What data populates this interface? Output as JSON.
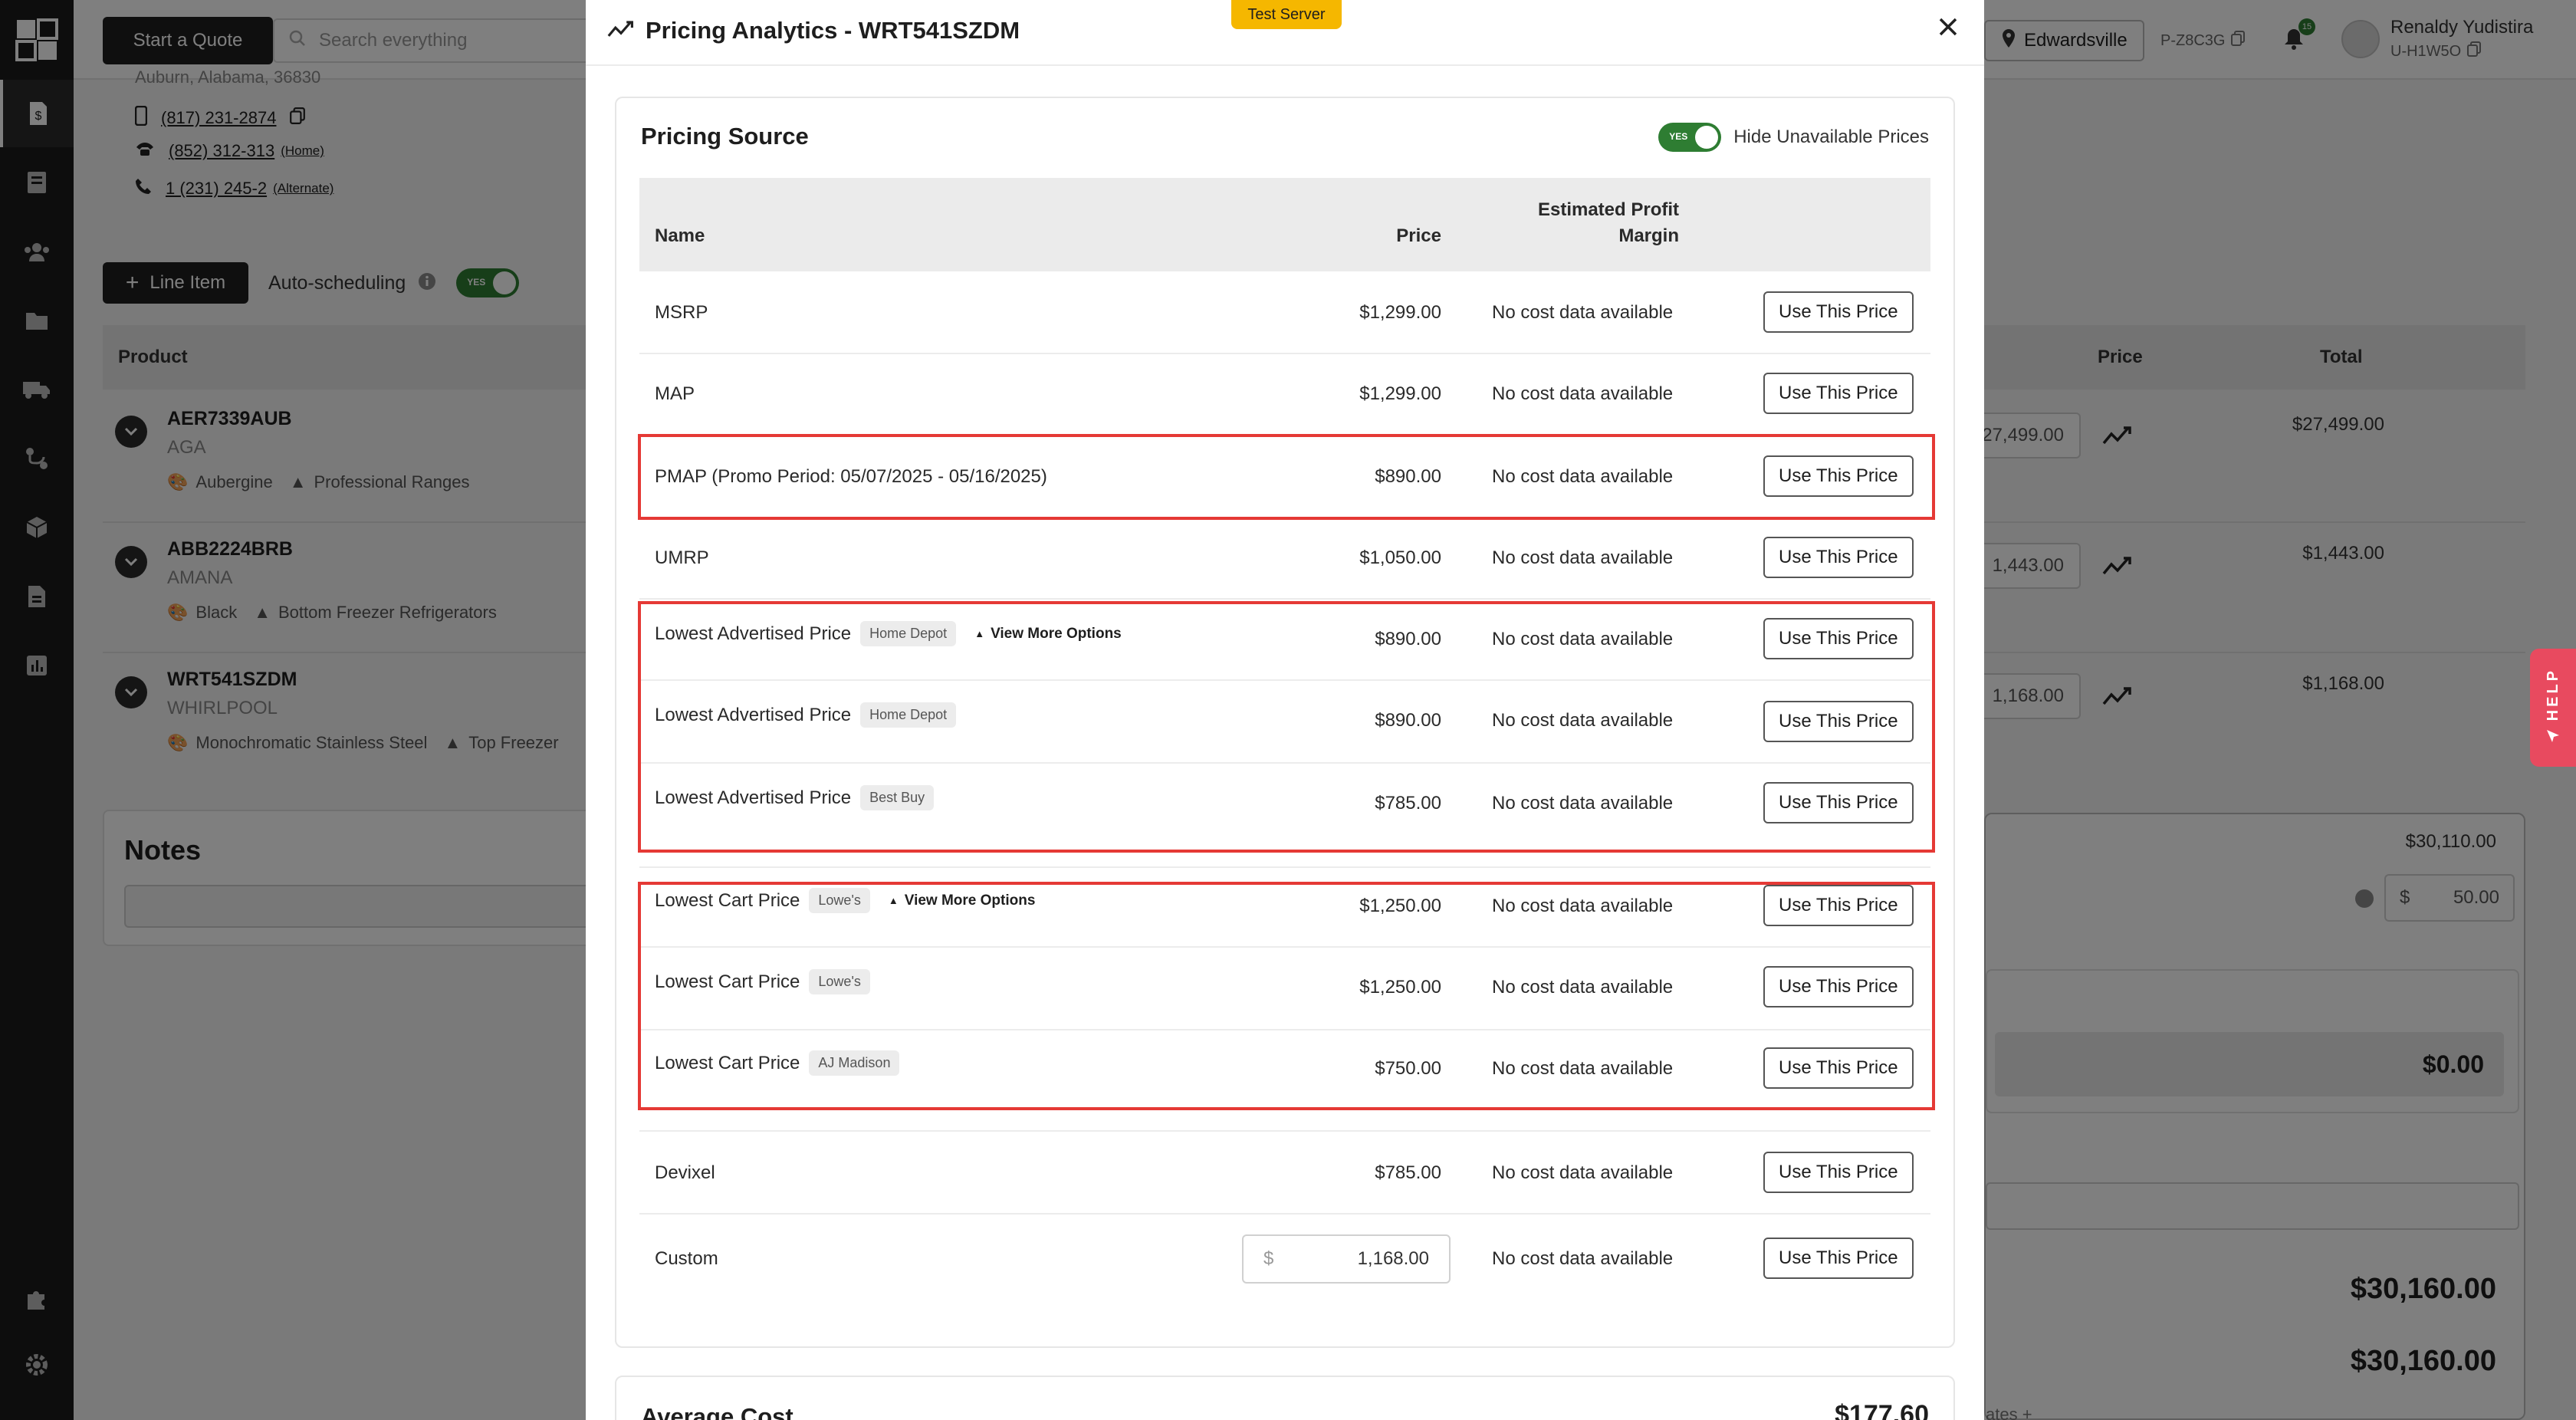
{
  "app": {
    "start_quote_label": "Start a Quote",
    "search_placeholder": "Search everything",
    "location": "Edwardsville",
    "profile_code": "P-Z8C3G",
    "notification_count": "15",
    "user_name": "Renaldy Yudistira",
    "user_id": "U-H1W5O",
    "help_label": "HELP"
  },
  "customer": {
    "address_partial": "Auburn, Alabama, 36830",
    "phone_mobile": "(817) 231-2874",
    "phone_home": "(852) 312-313",
    "phone_home_tag": "(Home)",
    "phone_alt": "1 (231) 245-2",
    "phone_alt_tag": "(Alternate)"
  },
  "toolbar": {
    "line_item_label": "Line Item",
    "auto_scheduling_label": "Auto-scheduling",
    "toggle_yes": "YES"
  },
  "products_table": {
    "headers": {
      "product": "Product",
      "price": "Price",
      "total": "Total"
    },
    "rows": [
      {
        "code": "AER7339AUB",
        "brand": "AGA",
        "color": "Aubergine",
        "category": "Professional Ranges",
        "price": "27,499.00",
        "total": "$27,499.00"
      },
      {
        "code": "ABB2224BRB",
        "brand": "AMANA",
        "color": "Black",
        "category": "Bottom Freezer Refrigerators",
        "price": "1,443.00",
        "total": "$1,443.00"
      },
      {
        "code": "WRT541SZDM",
        "brand": "WHIRLPOOL",
        "color": "Monochromatic Stainless Steel",
        "category": "Top Freezer",
        "price": "1,168.00",
        "total": "$1,168.00"
      }
    ]
  },
  "notes": {
    "title": "Notes"
  },
  "summary": {
    "subtotal": "$30,110.00",
    "fee_currency": "$",
    "fee_value": "50.00",
    "zero_value": "$0.00",
    "total_1": "$30,160.00",
    "total_2": "$30,160.00",
    "rates_label": "ates +"
  },
  "modal": {
    "title": "Pricing Analytics - WRT541SZDM",
    "badge": "Test Server",
    "section_title": "Pricing Source",
    "toggle_yes": "YES",
    "hide_label": "Hide Unavailable Prices",
    "headers": {
      "name": "Name",
      "price": "Price",
      "margin_line1": "Estimated Profit",
      "margin_line2": "Margin"
    },
    "rows": [
      {
        "name": "MSRP",
        "price": "$1,299.00",
        "margin": "No cost data available",
        "action": "Use This Price"
      },
      {
        "name": "MAP",
        "price": "$1,299.00",
        "margin": "No cost data available",
        "action": "Use This Price"
      },
      {
        "name": "PMAP (Promo Period: 05/07/2025 - 05/16/2025)",
        "price": "$890.00",
        "margin": "No cost data available",
        "action": "Use This Price"
      },
      {
        "name": "UMRP",
        "price": "$1,050.00",
        "margin": "No cost data available",
        "action": "Use This Price"
      },
      {
        "name": "Lowest Advertised Price",
        "tag": "Home Depot",
        "more": "View More Options",
        "price": "$890.00",
        "margin": "No cost data available",
        "action": "Use This Price"
      },
      {
        "name": "Lowest Advertised Price",
        "tag": "Home Depot",
        "price": "$890.00",
        "margin": "No cost data available",
        "action": "Use This Price"
      },
      {
        "name": "Lowest Advertised Price",
        "tag": "Best Buy",
        "price": "$785.00",
        "margin": "No cost data available",
        "action": "Use This Price"
      },
      {
        "name": "Lowest Cart Price",
        "tag": "Lowe's",
        "more": "View More Options",
        "price": "$1,250.00",
        "margin": "No cost data available",
        "action": "Use This Price"
      },
      {
        "name": "Lowest Cart Price",
        "tag": "Lowe's",
        "price": "$1,250.00",
        "margin": "No cost data available",
        "action": "Use This Price"
      },
      {
        "name": "Lowest Cart Price",
        "tag": "AJ Madison",
        "price": "$750.00",
        "margin": "No cost data available",
        "action": "Use This Price"
      },
      {
        "name": "Devixel",
        "price": "$785.00",
        "margin": "No cost data available",
        "action": "Use This Price"
      },
      {
        "name": "Custom",
        "currency": "$",
        "value": "1,168.00",
        "margin": "No cost data available",
        "action": "Use This Price"
      }
    ],
    "average_cost_label": "Average Cost",
    "average_cost_value": "$177.60"
  },
  "colors": {
    "accent_green": "#2e7d32",
    "highlight_red": "#e53935",
    "badge_yellow": "#f5b700",
    "help_pink": "#e84a5f"
  }
}
